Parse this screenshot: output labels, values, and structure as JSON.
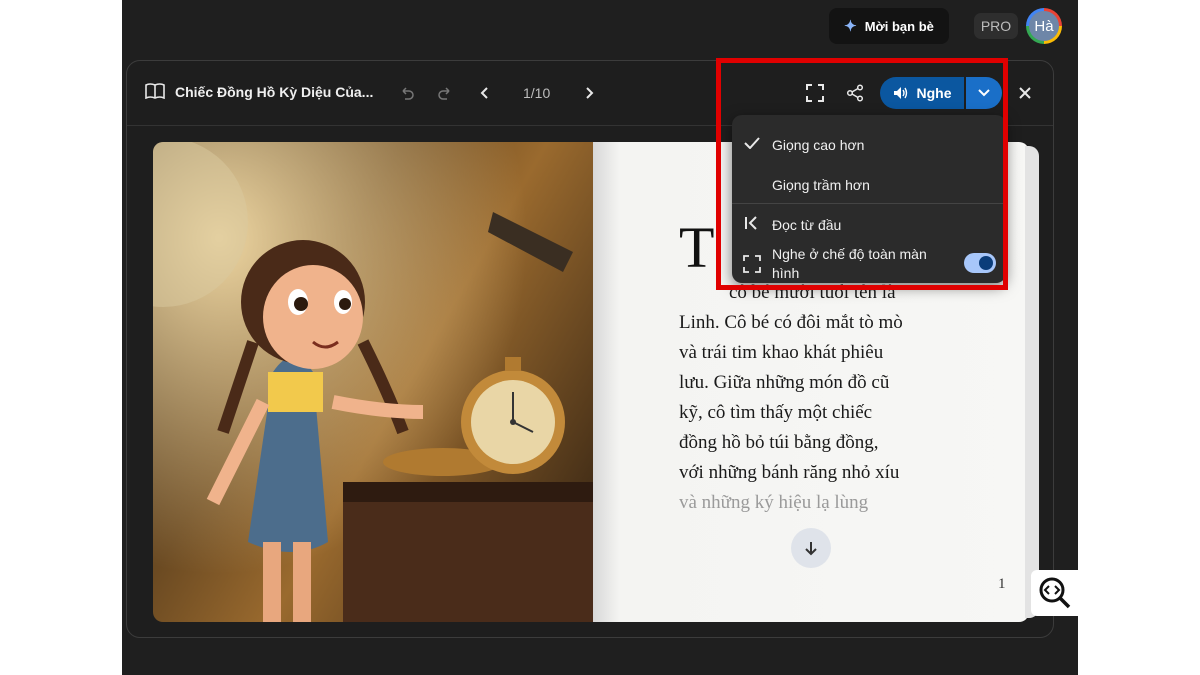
{
  "topbar": {
    "invite_label": "Mời bạn bè",
    "pro_label": "PRO",
    "avatar_initials": "Hà"
  },
  "reader": {
    "book_title": "Chiếc Đồng Hồ Kỳ Diệu Của...",
    "page_indicator": "1/10",
    "listen_label": "Nghe",
    "icons": {
      "book": "book-open-icon",
      "undo": "undo-icon",
      "redo": "redo-icon",
      "prev": "chevron-left-icon",
      "next": "chevron-right-icon",
      "fullscreen": "fullscreen-icon",
      "share": "share-icon",
      "speaker": "speaker-icon",
      "dropdown": "chevron-down-icon",
      "close": "close-icon"
    },
    "colors": {
      "listen_button": "#0b57a0",
      "dropdown_button": "#1a6fc8",
      "highlight_border": "#e00000"
    }
  },
  "menu": {
    "voice_higher": "Giọng cao hơn",
    "voice_lower": "Giọng trầm hơn",
    "read_from_start": "Đọc từ đầu",
    "fullscreen_listen": "Nghe ở chế độ toàn màn hình",
    "fullscreen_toggle_on": true,
    "selected_voice": "Giọng cao hơn"
  },
  "page": {
    "drop_cap": "T",
    "partial_line": "cô bé mười tuổi tên là",
    "lines": [
      "Linh. Cô bé có đôi mắt tò mò",
      "và trái tim khao khát phiêu",
      "lưu. Giữa những món đồ cũ",
      "kỹ, cô tìm thấy một chiếc",
      "đồng hồ bỏ túi bằng đồng,",
      "với những bánh răng nhỏ xíu"
    ],
    "faded_line": "và những ký hiệu lạ lùng",
    "page_number": "1"
  }
}
